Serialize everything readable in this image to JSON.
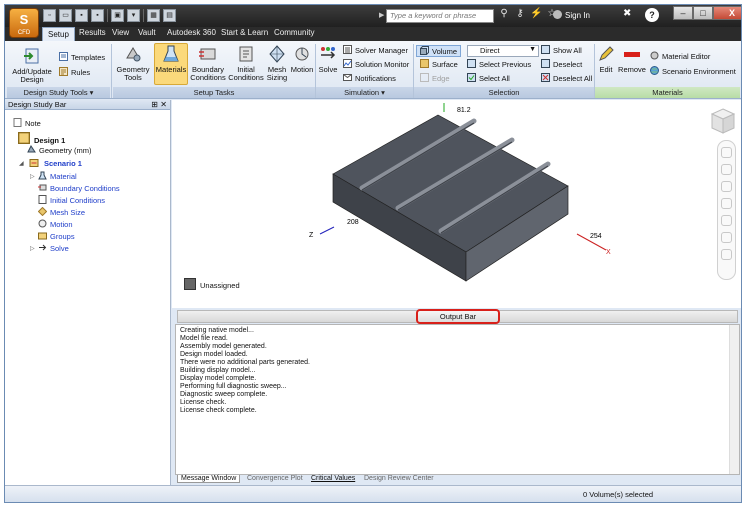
{
  "app": {
    "badge": "CFD"
  },
  "titlebar": {
    "search_placeholder": "Type a keyword or phrase",
    "sign_in": "Sign In",
    "help": "?",
    "minimize": "–",
    "maximize": "□",
    "close": "X"
  },
  "tabs": [
    "Setup",
    "Results",
    "View",
    "Vault",
    "Autodesk 360",
    "Start & Learn",
    "Community"
  ],
  "ribbon": {
    "design_study_tools": {
      "add_update_design": "Add/Update Design",
      "templates": "Templates",
      "rules": "Rules",
      "label": "Design Study Tools ▾"
    },
    "setup_tasks": {
      "geometry_tools": "Geometry Tools",
      "materials": "Materials",
      "boundary_conditions": "Boundary Conditions",
      "initial_conditions": "Initial Conditions",
      "mesh_sizing": "Mesh Sizing",
      "motion": "Motion",
      "label": "Setup Tasks"
    },
    "simulation": {
      "solve": "Solve",
      "solver_manager": "Solver Manager",
      "solution_monitor": "Solution Monitor",
      "notifications": "Notifications",
      "label": "Simulation ▾"
    },
    "selection": {
      "volume": "Volume",
      "surface": "Surface",
      "edge": "Edge",
      "direct": "Direct",
      "select_previous": "Select Previous",
      "select_all": "Select All",
      "show_all": "Show All",
      "deselect": "Deselect",
      "deselect_all": "Deselect All",
      "label": "Selection"
    },
    "materials": {
      "edit": "Edit",
      "remove": "Remove",
      "material_editor": "Material Editor",
      "scenario_environment": "Scenario Environment",
      "label": "Materials"
    }
  },
  "left_panel": {
    "title": "Design Study Bar",
    "pin": "⊞",
    "close": "✕",
    "tree": {
      "note": "Note",
      "design": "Design 1",
      "geometry": "Geometry (mm)",
      "scenario": "Scenario 1",
      "children": [
        "Material",
        "Boundary Conditions",
        "Initial Conditions",
        "Mesh Size",
        "Motion",
        "Groups",
        "Solve"
      ]
    }
  },
  "viewport": {
    "axis_y_value": "81.2",
    "axis_z_value": "208",
    "axis_z_label": "Z",
    "axis_x_value": "254",
    "axis_x_label": "X",
    "legend_label": "Unassigned"
  },
  "output_bar": {
    "button_label": "Output Bar",
    "messages": [
      "Creating native model...",
      "Model file read.",
      "Assembly model generated.",
      "Design model loaded.",
      "There were no additional parts generated.",
      "Building display model...",
      "Display model complete.",
      "Performing full diagnostic sweep...",
      "Diagnostic sweep complete.",
      "License check.",
      "License check complete."
    ],
    "tabs": [
      "Message Window",
      "Convergence Plot",
      "Critical Values",
      "Design Review Center"
    ]
  },
  "status": {
    "selection": "0 Volume(s) selected"
  },
  "colors": {
    "accent": "#fbd97b",
    "highlight": "#d8201a",
    "tree_link": "#1f3ec9",
    "model_body": "#555a63"
  }
}
